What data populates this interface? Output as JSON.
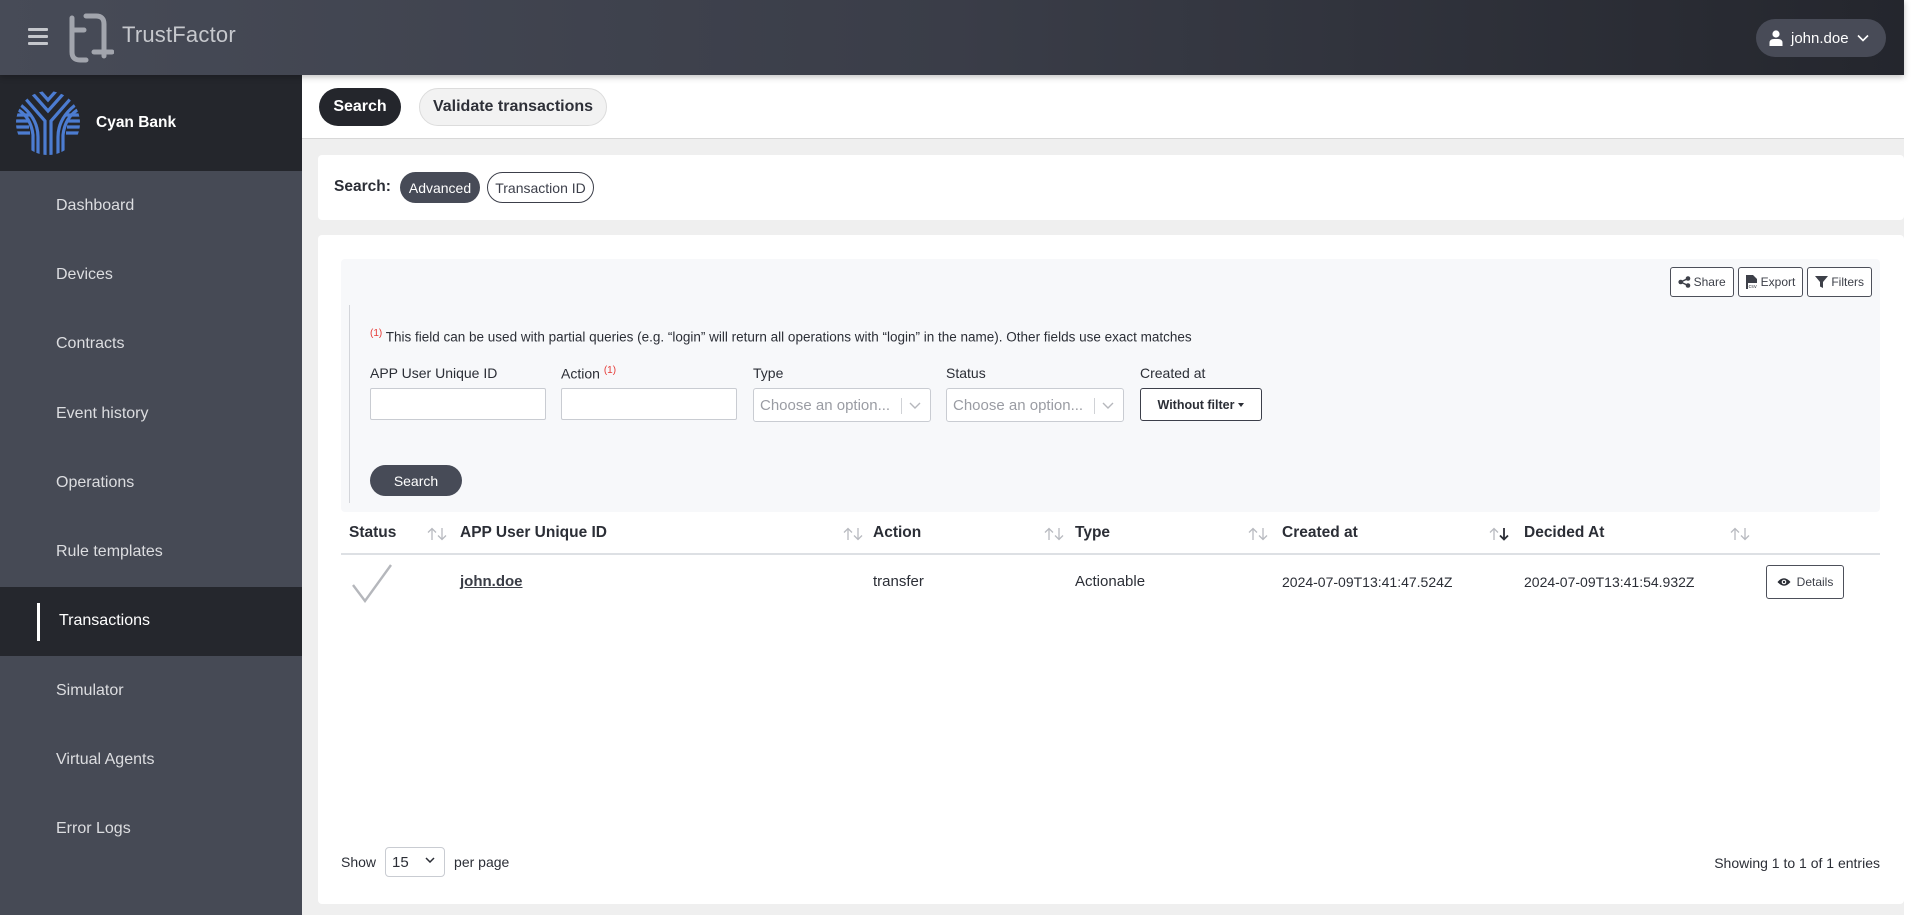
{
  "header": {
    "brand": "TrustFactor",
    "user": "john.doe",
    "menu_icon": "hamburger-icon",
    "logo_icon": "trustfactor-logo",
    "user_icon": "user-icon"
  },
  "sidebar": {
    "org_name": "Cyan Bank",
    "items": [
      {
        "label": "Dashboard",
        "active": false
      },
      {
        "label": "Devices",
        "active": false
      },
      {
        "label": "Contracts",
        "active": false
      },
      {
        "label": "Event history",
        "active": false
      },
      {
        "label": "Operations",
        "active": false
      },
      {
        "label": "Rule templates",
        "active": false
      },
      {
        "label": "Transactions",
        "active": true
      },
      {
        "label": "Simulator",
        "active": false
      },
      {
        "label": "Virtual Agents",
        "active": false
      },
      {
        "label": "Error Logs",
        "active": false
      }
    ]
  },
  "tabs": [
    {
      "label": "Search",
      "active": true
    },
    {
      "label": "Validate transactions",
      "active": false
    }
  ],
  "search_mode": {
    "label": "Search:",
    "options": [
      {
        "label": "Advanced",
        "active": true
      },
      {
        "label": "Transaction ID",
        "active": false
      }
    ]
  },
  "toolbar": {
    "share": "Share",
    "export": "Export",
    "filters": "Filters"
  },
  "filters": {
    "note_marker": "(1)",
    "note": "This field can be used with partial queries (e.g. “login” will return all operations with “login” in the name). Other fields use exact matches",
    "app_user_label": "APP User Unique ID",
    "app_user_value": "",
    "action_label": "Action",
    "action_marker": "(1)",
    "action_value": "",
    "type_label": "Type",
    "type_placeholder": "Choose an option...",
    "status_label": "Status",
    "status_placeholder": "Choose an option...",
    "created_label": "Created at",
    "created_value": "Without filter",
    "search_button": "Search"
  },
  "table": {
    "columns": [
      "Status",
      "APP User Unique ID",
      "Action",
      "Type",
      "Created at",
      "Decided At"
    ],
    "sorted_column": "Created at",
    "sort_direction": "desc",
    "rows": [
      {
        "status": "approved",
        "status_icon": "check-icon",
        "app_user": "john.doe",
        "action": "transfer",
        "type": "Actionable",
        "created_at": "2024-07-09T13:41:47.524Z",
        "decided_at": "2024-07-09T13:41:54.932Z",
        "details_label": "Details"
      }
    ]
  },
  "pagination": {
    "show_label": "Show",
    "per_page_value": "15",
    "per_page_label": "per page",
    "summary": "Showing 1 to 1 of 1 entries"
  }
}
